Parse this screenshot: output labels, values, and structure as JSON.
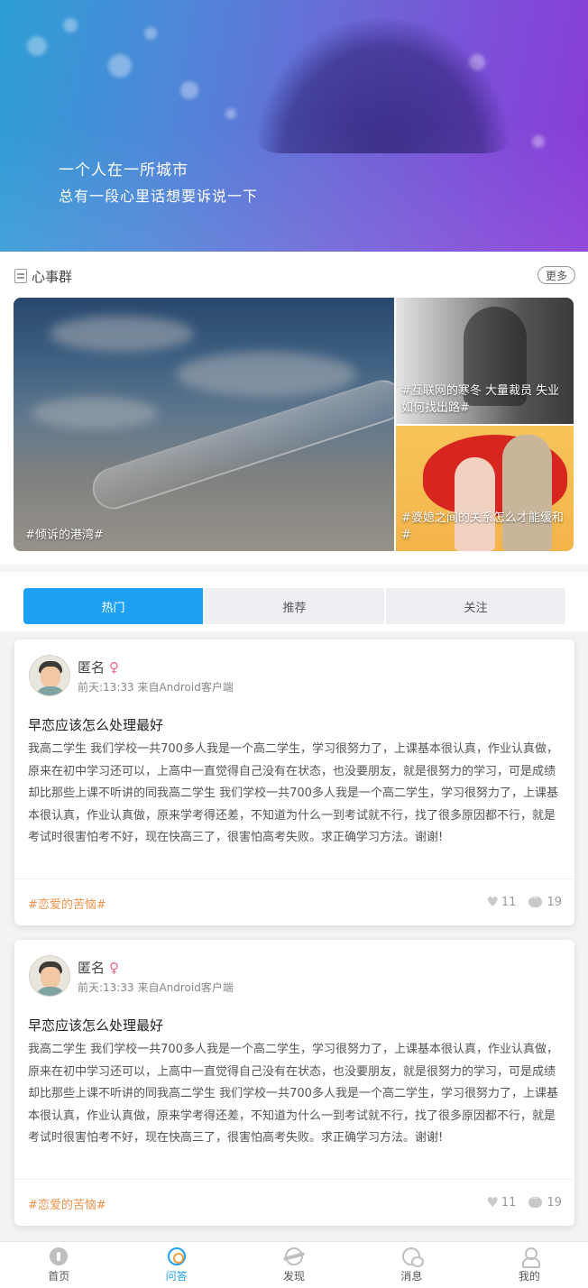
{
  "banner": {
    "line1": "一个人在一所城市",
    "line2": "总有一段心里话想要诉说一下"
  },
  "section": {
    "title": "心事群",
    "more_label": "更多",
    "tiles": [
      {
        "caption": "#倾诉的港湾#"
      },
      {
        "caption": "#互联网的寒冬 大量裁员 失业如何找出路#"
      },
      {
        "caption": "#婆媳之间的关系怎么才能缓和#"
      }
    ]
  },
  "tabs": [
    {
      "label": "热门",
      "active": true
    },
    {
      "label": "推荐",
      "active": false
    },
    {
      "label": "关注",
      "active": false
    }
  ],
  "posts": [
    {
      "author": "匿名",
      "gender_symbol": "♀",
      "meta": "前天:13:33 来自Android客户端",
      "title": "早恋应该怎么处理最好",
      "body": "我高二学生 我们学校一共700多人我是一个高二学生，学习很努力了，上课基本很认真，作业认真做，原来在初中学习还可以，上高中一直觉得自己没有在状态，也没要朋友，就是很努力的学习，可是成绩却比那些上课不听讲的同我高二学生 我们学校一共700多人我是一个高二学生，学习很努力了，上课基本很认真，作业认真做，原来学考得还差，不知道为什么一到考试就不行，找了很多原因都不行，就是考试时很害怕考不好，现在快高三了，很害怕高考失败。求正确学习方法。谢谢!",
      "tag": "#恋爱的苦恼#",
      "likes": "11",
      "comments": "19"
    },
    {
      "author": "匿名",
      "gender_symbol": "♀",
      "meta": "前天:13:33 来自Android客户端",
      "title": "早恋应该怎么处理最好",
      "body": "我高二学生 我们学校一共700多人我是一个高二学生，学习很努力了，上课基本很认真，作业认真做，原来在初中学习还可以，上高中一直觉得自己没有在状态，也没要朋友，就是很努力的学习，可是成绩却比那些上课不听讲的同我高二学生 我们学校一共700多人我是一个高二学生，学习很努力了，上课基本很认真，作业认真做，原来学考得还差，不知道为什么一到考试就不行，找了很多原因都不行，就是考试时很害怕考不好，现在快高三了，很害怕高考失败。求正确学习方法。谢谢!",
      "tag": "#恋爱的苦恼#",
      "likes": "11",
      "comments": "19"
    }
  ],
  "nav": [
    {
      "label": "首页",
      "icon": "home-icon",
      "active": false
    },
    {
      "label": "问答",
      "icon": "qa-icon",
      "active": true
    },
    {
      "label": "发现",
      "icon": "discover-icon",
      "active": false
    },
    {
      "label": "消息",
      "icon": "message-icon",
      "active": false
    },
    {
      "label": "我的",
      "icon": "profile-icon",
      "active": false
    }
  ],
  "colors": {
    "accent": "#1ea1f2",
    "tag": "#f1924b",
    "female": "#f06a86"
  }
}
